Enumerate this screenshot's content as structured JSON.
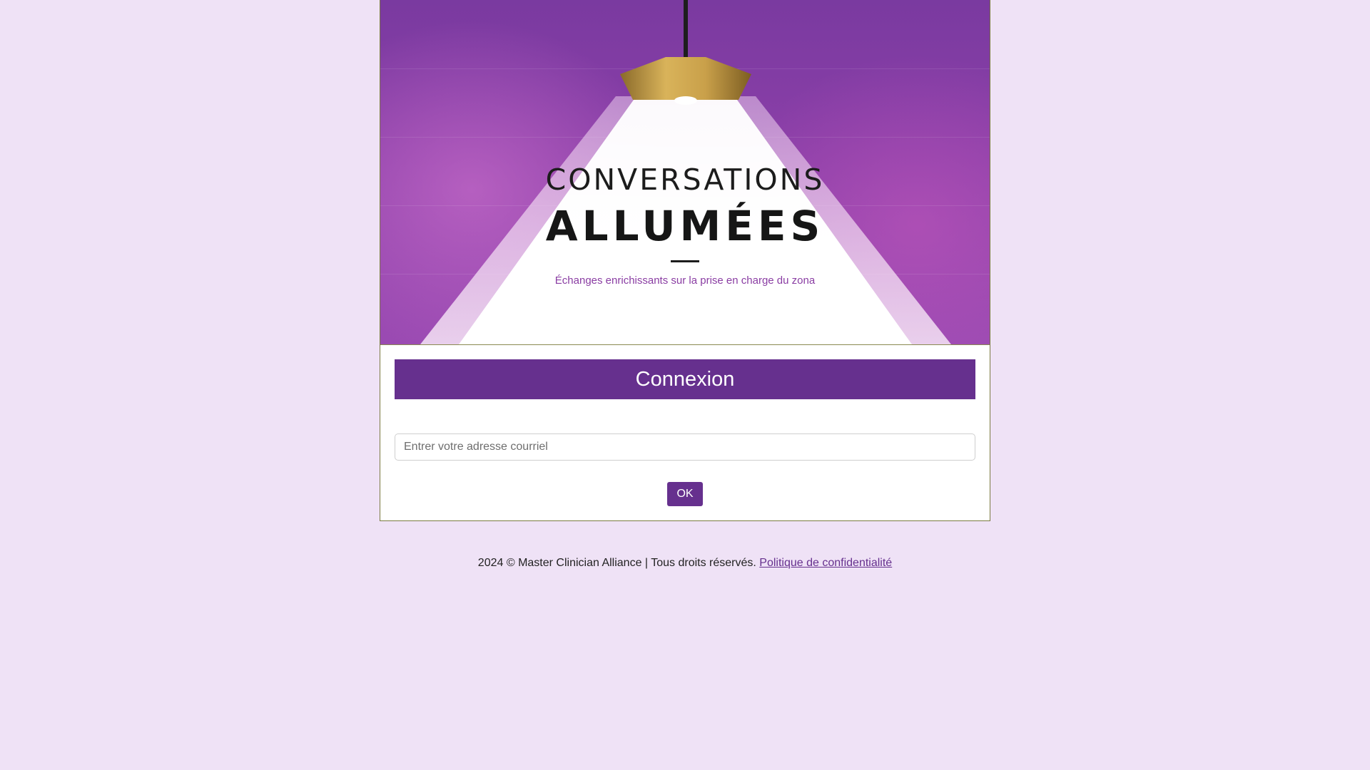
{
  "banner": {
    "logo_line1": "CONVERSATIONS",
    "logo_line2": "ALLUMÉES",
    "tagline": "Échanges enrichissants sur la prise en charge du zona"
  },
  "login": {
    "heading": "Connexion",
    "email_placeholder": "Entrer votre adresse courriel",
    "email_value": "",
    "submit_label": "OK"
  },
  "footer": {
    "copyright": "2024 © Master Clinician Alliance | Tous droits réservés.",
    "privacy_link": "Politique de confidentialité"
  },
  "colors": {
    "page_background": "#efe2f6",
    "accent": "#66308e",
    "tagline": "#8a3da3"
  },
  "icons": {
    "banner_illustration": "pendant-lamp-icon"
  }
}
